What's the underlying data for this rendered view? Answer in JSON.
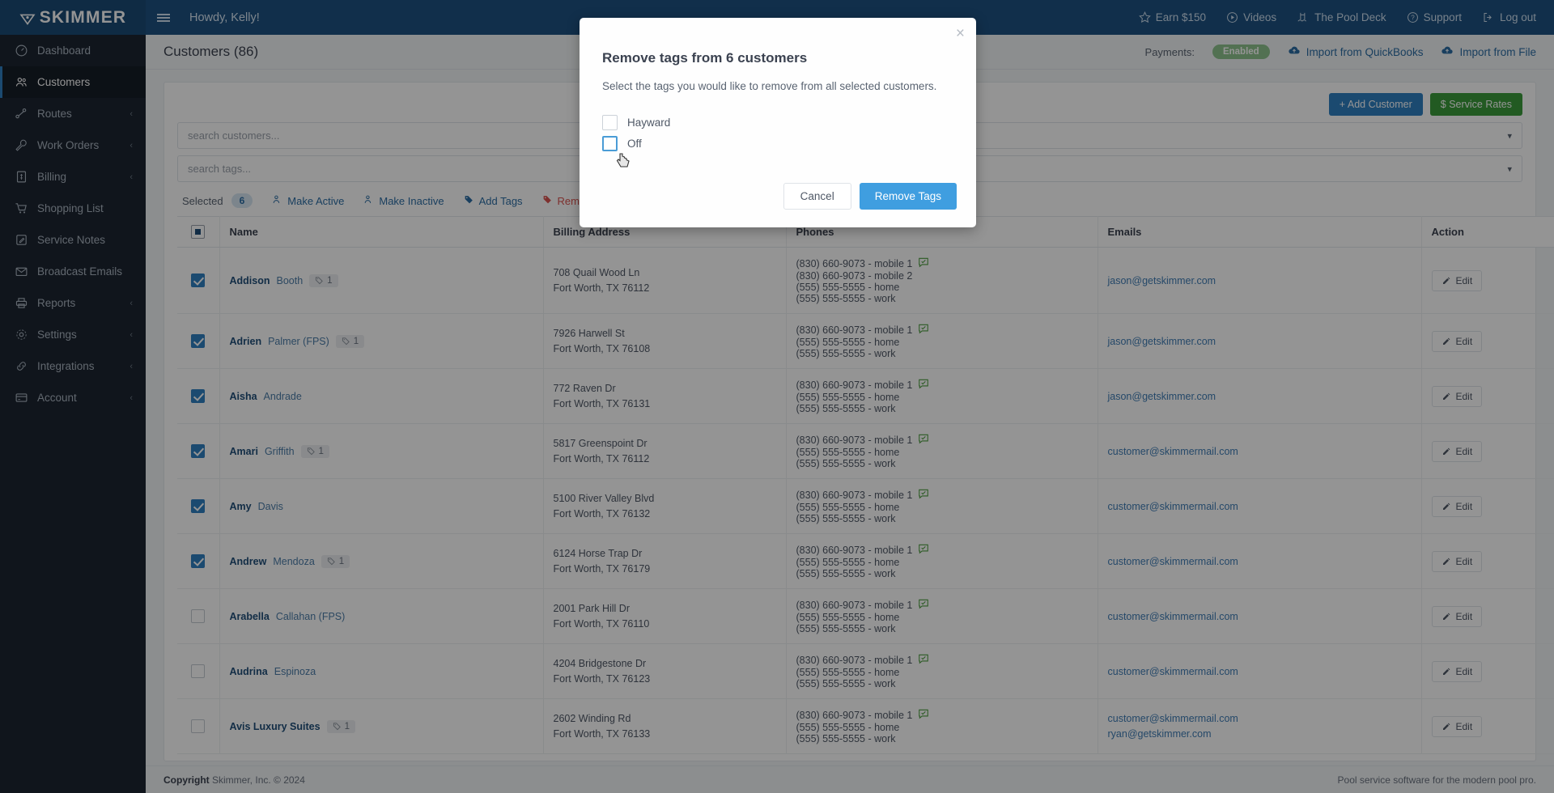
{
  "brand": {
    "name": "SKIMMER"
  },
  "topbar": {
    "greeting": "Howdy, Kelly!",
    "nav": [
      {
        "label": "Earn $150",
        "icon": "star-icon"
      },
      {
        "label": "Videos",
        "icon": "play-circle-icon"
      },
      {
        "label": "The Pool Deck",
        "icon": "pool-icon"
      },
      {
        "label": "Support",
        "icon": "question-circle-icon"
      },
      {
        "label": "Log out",
        "icon": "logout-icon"
      }
    ]
  },
  "sidebar": {
    "items": [
      {
        "label": "Dashboard",
        "icon": "gauge-icon",
        "active": false,
        "caret": false
      },
      {
        "label": "Customers",
        "icon": "users-icon",
        "active": true,
        "caret": false
      },
      {
        "label": "Routes",
        "icon": "route-icon",
        "active": false,
        "caret": true
      },
      {
        "label": "Work Orders",
        "icon": "wrench-icon",
        "active": false,
        "caret": true
      },
      {
        "label": "Billing",
        "icon": "invoice-icon",
        "active": false,
        "caret": true
      },
      {
        "label": "Shopping List",
        "icon": "cart-icon",
        "active": false,
        "caret": false
      },
      {
        "label": "Service Notes",
        "icon": "note-edit-icon",
        "active": false,
        "caret": false
      },
      {
        "label": "Broadcast Emails",
        "icon": "envelope-icon",
        "active": false,
        "caret": false
      },
      {
        "label": "Reports",
        "icon": "printer-icon",
        "active": false,
        "caret": true
      },
      {
        "label": "Settings",
        "icon": "gear-icon",
        "active": false,
        "caret": true
      },
      {
        "label": "Integrations",
        "icon": "link-icon",
        "active": false,
        "caret": true
      },
      {
        "label": "Account",
        "icon": "card-icon",
        "active": false,
        "caret": true
      }
    ]
  },
  "page": {
    "title": "Customers (86)",
    "payments_label": "Payments:",
    "payments_status": "Enabled",
    "import_quickbooks": "Import from QuickBooks",
    "import_file": "Import from File",
    "add_customer": "+ Add Customer",
    "service_rates": "$ Service Rates"
  },
  "filters": {
    "customer_search_placeholder": "search customers...",
    "customer_search_value": "",
    "tag_search_placeholder": "search tags...",
    "tag_search_value": ""
  },
  "bulkbar": {
    "selected_label": "Selected",
    "selected_count": "6",
    "make_active": "Make Active",
    "make_inactive": "Make Inactive",
    "add_tags": "Add Tags",
    "remove_tags": "Remove Tags"
  },
  "table": {
    "headers": [
      "Name",
      "Billing Address",
      "Phones",
      "Emails",
      "Action"
    ],
    "edit_label": "Edit",
    "rows": [
      {
        "checked": true,
        "first": "Addison",
        "last": "Booth",
        "tag_count": "1",
        "address": [
          "708 Quail Wood Ln",
          "Fort Worth, TX 76112"
        ],
        "phones": [
          "(830) 660-9073 - mobile 1",
          "(830) 660-9073 - mobile 2",
          "(555) 555-5555 - home",
          "(555) 555-5555 - work"
        ],
        "emails": [
          "jason@getskimmer.com"
        ]
      },
      {
        "checked": true,
        "first": "Adrien",
        "last": "Palmer (FPS)",
        "tag_count": "1",
        "address": [
          "7926 Harwell St",
          "Fort Worth, TX 76108"
        ],
        "phones": [
          "(830) 660-9073 - mobile 1",
          "(555) 555-5555 - home",
          "(555) 555-5555 - work"
        ],
        "emails": [
          "jason@getskimmer.com"
        ]
      },
      {
        "checked": true,
        "first": "Aisha",
        "last": "Andrade",
        "tag_count": "",
        "address": [
          "772 Raven Dr",
          "Fort Worth, TX 76131"
        ],
        "phones": [
          "(830) 660-9073 - mobile 1",
          "(555) 555-5555 - home",
          "(555) 555-5555 - work"
        ],
        "emails": [
          "jason@getskimmer.com"
        ]
      },
      {
        "checked": true,
        "first": "Amari",
        "last": "Griffith",
        "tag_count": "1",
        "address": [
          "5817 Greenspoint Dr",
          "Fort Worth, TX 76112"
        ],
        "phones": [
          "(830) 660-9073 - mobile 1",
          "(555) 555-5555 - home",
          "(555) 555-5555 - work"
        ],
        "emails": [
          "customer@skimmermail.com"
        ]
      },
      {
        "checked": true,
        "first": "Amy",
        "last": "Davis",
        "tag_count": "",
        "address": [
          "5100 River Valley Blvd",
          "Fort Worth, TX 76132"
        ],
        "phones": [
          "(830) 660-9073 - mobile 1",
          "(555) 555-5555 - home",
          "(555) 555-5555 - work"
        ],
        "emails": [
          "customer@skimmermail.com"
        ]
      },
      {
        "checked": true,
        "first": "Andrew",
        "last": "Mendoza",
        "tag_count": "1",
        "address": [
          "6124 Horse Trap Dr",
          "Fort Worth, TX 76179"
        ],
        "phones": [
          "(830) 660-9073 - mobile 1",
          "(555) 555-5555 - home",
          "(555) 555-5555 - work"
        ],
        "emails": [
          "customer@skimmermail.com"
        ]
      },
      {
        "checked": false,
        "first": "Arabella",
        "last": "Callahan (FPS)",
        "tag_count": "",
        "address": [
          "2001 Park Hill Dr",
          "Fort Worth, TX 76110"
        ],
        "phones": [
          "(830) 660-9073 - mobile 1",
          "(555) 555-5555 - home",
          "(555) 555-5555 - work"
        ],
        "emails": [
          "customer@skimmermail.com"
        ]
      },
      {
        "checked": false,
        "first": "Audrina",
        "last": "Espinoza",
        "tag_count": "",
        "address": [
          "4204 Bridgestone Dr",
          "Fort Worth, TX 76123"
        ],
        "phones": [
          "(830) 660-9073 - mobile 1",
          "(555) 555-5555 - home",
          "(555) 555-5555 - work"
        ],
        "emails": [
          "customer@skimmermail.com"
        ]
      },
      {
        "checked": false,
        "first": "Avis Luxury Suites",
        "last": "",
        "tag_count": "1",
        "address": [
          "2602 Winding Rd",
          "Fort Worth, TX 76133"
        ],
        "phones": [
          "(830) 660-9073 - mobile 1",
          "(555) 555-5555 - home",
          "(555) 555-5555 - work"
        ],
        "emails": [
          "customer@skimmermail.com",
          "ryan@getskimmer.com"
        ]
      }
    ]
  },
  "footer": {
    "copyright_bold": "Copyright",
    "copyright_rest": "Skimmer, Inc. © 2024",
    "tagline": "Pool service software for the modern pool pro."
  },
  "modal": {
    "title": "Remove tags from 6 customers",
    "subtitle": "Select the tags you would like to remove from all selected customers.",
    "tags": [
      {
        "label": "Hayward",
        "checked": false,
        "focused": false
      },
      {
        "label": "Off",
        "checked": false,
        "focused": true
      }
    ],
    "cancel": "Cancel",
    "confirm": "Remove Tags",
    "close_icon": "close-icon"
  },
  "colors": {
    "brand_blue": "#1d5182",
    "accent_blue": "#2f7fc1",
    "danger_red": "#d9534f",
    "success_green": "#3b9c3b",
    "sidebar_dark": "#1b2531"
  }
}
